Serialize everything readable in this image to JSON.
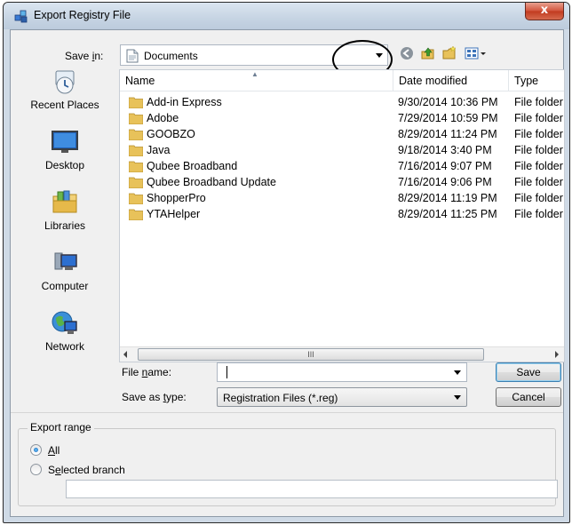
{
  "window": {
    "title": "Export Registry File",
    "close_label": "x"
  },
  "save_in": {
    "label": "Save in:",
    "value": "Documents"
  },
  "toolbar": {
    "icons": [
      "back-icon",
      "up-folder-icon",
      "new-folder-icon",
      "view-menu-icon"
    ]
  },
  "places": [
    {
      "label": "Recent Places",
      "icon": "recent-places-icon"
    },
    {
      "label": "Desktop",
      "icon": "desktop-icon"
    },
    {
      "label": "Libraries",
      "icon": "libraries-icon"
    },
    {
      "label": "Computer",
      "icon": "computer-icon"
    },
    {
      "label": "Network",
      "icon": "network-icon"
    }
  ],
  "file_list": {
    "columns": [
      "Name",
      "Date modified",
      "Type"
    ],
    "rows": [
      {
        "name": "Add-in Express",
        "date": "9/30/2014 10:36 PM",
        "type": "File folder"
      },
      {
        "name": "Adobe",
        "date": "7/29/2014 10:59 PM",
        "type": "File folder"
      },
      {
        "name": "GOOBZO",
        "date": "8/29/2014 11:24 PM",
        "type": "File folder"
      },
      {
        "name": "Java",
        "date": "9/18/2014 3:40 PM",
        "type": "File folder"
      },
      {
        "name": "Qubee Broadband",
        "date": "7/16/2014 9:07 PM",
        "type": "File folder"
      },
      {
        "name": "Qubee Broadband Update",
        "date": "7/16/2014 9:06 PM",
        "type": "File folder"
      },
      {
        "name": "ShopperPro",
        "date": "8/29/2014 11:19 PM",
        "type": "File folder"
      },
      {
        "name": "YTAHelper",
        "date": "8/29/2014 11:25 PM",
        "type": "File folder"
      }
    ],
    "scroll_thumb_label": "III"
  },
  "file_name": {
    "label": "File name:",
    "value": ""
  },
  "save_as_type": {
    "label": "Save as type:",
    "value": "Registration Files (*.reg)"
  },
  "buttons": {
    "save": "Save",
    "cancel": "Cancel"
  },
  "export_range": {
    "title": "Export range",
    "all_label": "All",
    "selected_branch_label": "Selected branch",
    "selected": "All",
    "branch_value": ""
  },
  "colors": {
    "folder": "#e8c25a",
    "titlebar": "#c6d4e3",
    "close": "#c13a1f"
  }
}
